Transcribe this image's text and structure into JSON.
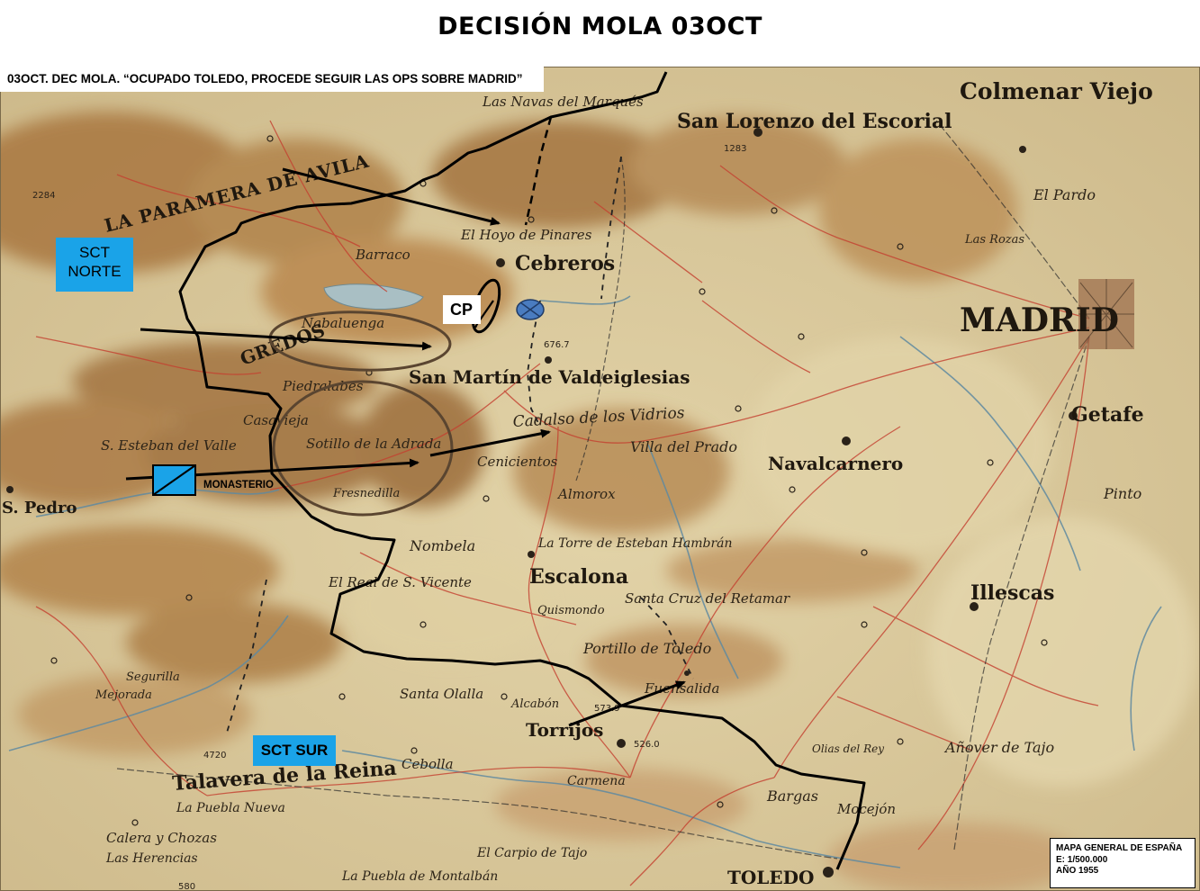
{
  "title": "DECISIÓN MOLA 03OCT",
  "caption": "03OCT. DEC MOLA. “OCUPADO TOLEDO, PROCEDE SEGUIR LAS OPS SOBRE MADRID”",
  "units": {
    "sct_norte_line1": "SCT",
    "sct_norte_line2": "NORTE",
    "sct_sur": "SCT SUR",
    "cp": "CP",
    "monasterio": "MONASTERIO"
  },
  "legend": {
    "line1": "MAPA GENERAL DE ESPAÑA",
    "line2": "E: 1/500.000",
    "line3": "AÑO 1955"
  },
  "places": {
    "colmenar": "Colmenar Viejo",
    "escorial": "San Lorenzo del Escorial",
    "paramera": "LA PARAMERA DE AVILA",
    "navas": "Las Navas del Marqués",
    "hoyo": "El Hoyo de Pinares",
    "cebreros": "Cebreros",
    "el_pardo": "El Pardo",
    "las_rozas": "Las Rozas",
    "madrid": "MADRID",
    "barraco": "Barraco",
    "nabalueng": "Nabaluenga",
    "gredos": "GREDOS",
    "san_martin": "San Martín de Valdeiglesias",
    "cadalso": "Cadalso de los Vidrios",
    "villa_prado": "Villa del Prado",
    "navalcarnero": "Navalcarnero",
    "getafe": "Getafe",
    "pinto": "Pinto",
    "piedralabes": "Piedralabes",
    "casavieja": "Casavieja",
    "sotillo": "Sotillo de la Adrada",
    "fresnedilla": "Fresnedilla",
    "esteban": "S. Esteban del Valle",
    "san_pedro": "S. Pedro",
    "cenicientos": "Cenicientos",
    "almorox": "Almorox",
    "escalona": "Escalona",
    "nombela": "Nombela",
    "torre": "La Torre de Esteban Hambrán",
    "illescas": "Illescas",
    "real_vicente": "El Real de S. Vicente",
    "santa_cruz": "Santa Cruz del Retamar",
    "portillo": "Portillo de Toledo",
    "fuensalida": "Fuensalida",
    "torrijos": "Torrijos",
    "santa_olalla": "Santa Olalla",
    "cebolla": "Cebolla",
    "talavera": "Talavera de la Reina",
    "bargas": "Bargas",
    "toledo": "TOLEDO",
    "olias": "Olias del Rey",
    "mocejon": "Mocejón",
    "anover": "Añover de Tajo",
    "puebla_nueva": "La Puebla Nueva",
    "chozas": "Calera y Chozas",
    "herencias": "Las Herencias",
    "carpio": "El Carpio de Tajo",
    "montalban": "La Puebla de Montalbán",
    "mejorada": "Mejorada",
    "segurilla": "Segurilla",
    "alcabon": "Alcabón",
    "quismondo": "Quismondo",
    "carmena": "Carmena"
  },
  "spot_heights": {
    "h_6767": "676.7",
    "h_5260": "526.0",
    "h_5739": "573.9",
    "h_2284": "2284",
    "h_1283": "1283",
    "h_580": "580",
    "h_4720": "4720"
  },
  "colors": {
    "unit_blue": "#1aa3e8",
    "enemy_blue": "#4a7cc0",
    "map_paper": "#d8c79a",
    "mountain_brown": "#a87a46",
    "road_red": "#c44030"
  }
}
